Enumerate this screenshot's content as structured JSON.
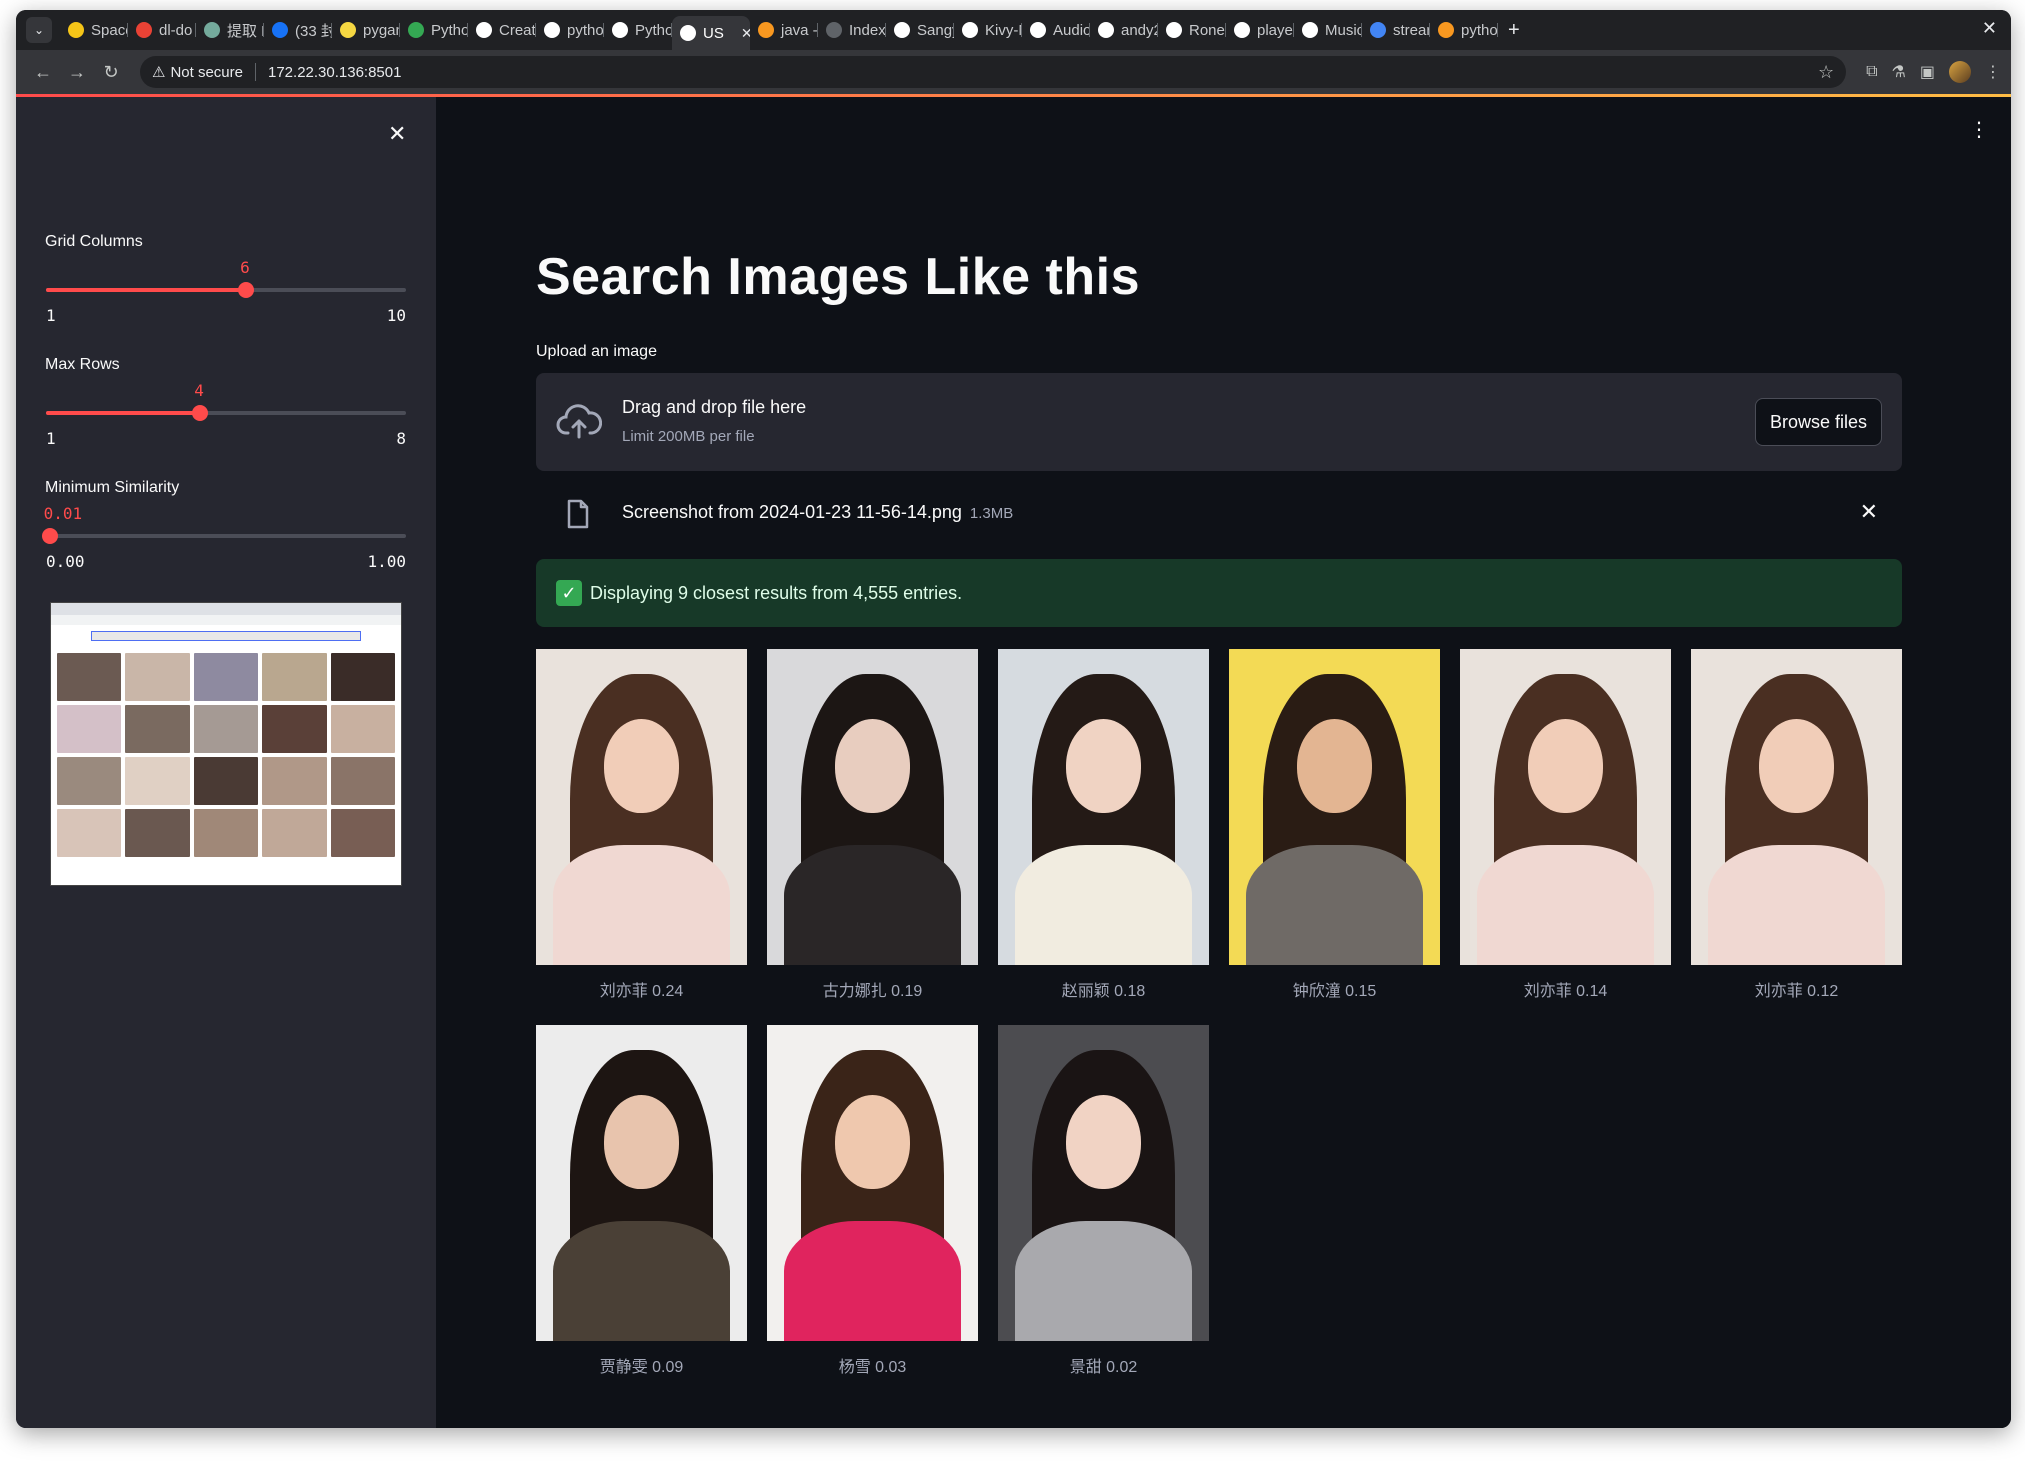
{
  "browser": {
    "tabs": [
      {
        "label": "Space",
        "icon": "hf-icon",
        "color": "#f5c518"
      },
      {
        "label": "dl-do",
        "icon": "red-app-icon",
        "color": "#e94235"
      },
      {
        "label": "提取 N",
        "icon": "chatgpt-icon",
        "color": "#74aa9c"
      },
      {
        "label": "(33 封",
        "icon": "zhihu-icon",
        "color": "#1772f6"
      },
      {
        "label": "pygan",
        "icon": "pygame-icon",
        "color": "#f5d742"
      },
      {
        "label": "Pytho",
        "icon": "dots-icon",
        "color": "#34a853"
      },
      {
        "label": "Creat",
        "icon": "medium-icon",
        "color": "#ffffff"
      },
      {
        "label": "pytho",
        "icon": "github-icon",
        "color": "#ffffff"
      },
      {
        "label": "Pytho",
        "icon": "github-icon",
        "color": "#ffffff"
      },
      {
        "label": "US",
        "icon": "streamlit-icon",
        "color": "#ffffff"
      },
      {
        "label": "java -",
        "icon": "java-icon",
        "color": "#f89820"
      },
      {
        "label": "Index",
        "icon": "blank-icon",
        "color": "#5f6368"
      },
      {
        "label": "Sangy",
        "icon": "github-icon",
        "color": "#ffffff"
      },
      {
        "label": "Kivy-N",
        "icon": "github-icon",
        "color": "#ffffff"
      },
      {
        "label": "Audio",
        "icon": "audio-icon",
        "color": "#ffffff"
      },
      {
        "label": "andy2",
        "icon": "github-icon",
        "color": "#ffffff"
      },
      {
        "label": "Ronel",
        "icon": "github-icon",
        "color": "#ffffff"
      },
      {
        "label": "player",
        "icon": "github-icon",
        "color": "#ffffff"
      },
      {
        "label": "Music",
        "icon": "github-icon",
        "color": "#ffffff"
      },
      {
        "label": "strear",
        "icon": "google-icon",
        "color": "#4285f4"
      },
      {
        "label": "pytho",
        "icon": "java-icon",
        "color": "#f89820"
      }
    ],
    "not_secure": "Not secure",
    "url": "172.22.30.136:8501"
  },
  "sidebar": {
    "grid_columns": {
      "label": "Grid Columns",
      "value": "6",
      "min": "1",
      "max": "10",
      "fraction": 0.556
    },
    "max_rows": {
      "label": "Max Rows",
      "value": "4",
      "min": "1",
      "max": "8",
      "fraction": 0.4286
    },
    "min_similarity": {
      "label": "Minimum Similarity",
      "value": "0.01",
      "min": "0.00",
      "max": "1.00",
      "fraction": 0.01
    }
  },
  "main": {
    "title": "Search Images Like this",
    "upload_label": "Upload an image",
    "dropzone_main": "Drag and drop file here",
    "dropzone_sub": "Limit 200MB per file",
    "browse_label": "Browse files",
    "file_name": "Screenshot from 2024-01-23 11-56-14.png",
    "file_size": "1.3MB",
    "success_text": "Displaying 9 closest results from 4,555 entries."
  },
  "results": [
    {
      "caption": "刘亦菲 0.24",
      "bg": "#e9e2dc",
      "hair": "#4a2f22",
      "face": "#f1cdb8",
      "body": "#f0d8d2"
    },
    {
      "caption": "古力娜扎 0.19",
      "bg": "#d9d9db",
      "hair": "#1c1614",
      "face": "#e8cdbf",
      "body": "#2a2627"
    },
    {
      "caption": "赵丽颖 0.18",
      "bg": "#d6dbe0",
      "hair": "#241a16",
      "face": "#f0d3c3",
      "body": "#f1ece0"
    },
    {
      "caption": "钟欣潼 0.15",
      "bg": "#f3da55",
      "hair": "#2a1c14",
      "face": "#e3b592",
      "body": "#6f6a66"
    },
    {
      "caption": "刘亦菲 0.14",
      "bg": "#e9e2dc",
      "hair": "#4a2f22",
      "face": "#f1cdb8",
      "body": "#f0d8d2"
    },
    {
      "caption": "刘亦菲 0.12",
      "bg": "#e9e2dc",
      "hair": "#4a2f22",
      "face": "#f1cdb8",
      "body": "#f0d8d2"
    },
    {
      "caption": "贾静雯 0.09",
      "bg": "#ececec",
      "hair": "#1d1512",
      "face": "#e8c4ad",
      "body": "#4a4036"
    },
    {
      "caption": "杨雪 0.03",
      "bg": "#f2f0ee",
      "hair": "#3a2418",
      "face": "#efc8ae",
      "body": "#e0245e"
    },
    {
      "caption": "景甜 0.02",
      "bg": "#4c4c50",
      "hair": "#1a1414",
      "face": "#f1d3c4",
      "body": "#a9a9ad"
    }
  ]
}
